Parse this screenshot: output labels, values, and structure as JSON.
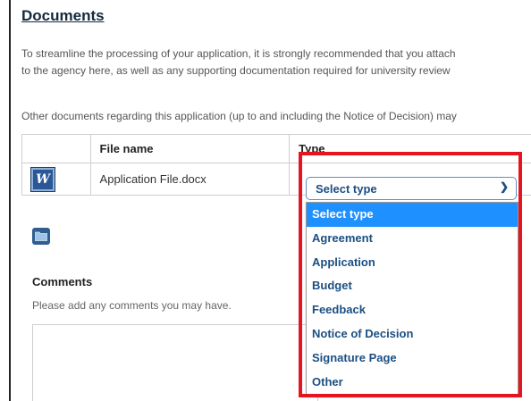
{
  "section": {
    "title": "Documents",
    "intro_line_1": "To streamline the processing of your application, it is strongly recommended that you attach",
    "intro_line_2": "to the agency here, as well as any supporting documentation required for university review",
    "other_docs_text": "Other documents regarding this application (up to and including the Notice of Decision) may"
  },
  "files_table": {
    "headers": {
      "file_name": "File name",
      "type": "Type"
    },
    "rows": [
      {
        "icon": "word-document-icon",
        "file_name": "Application File.docx",
        "type_value": "Select type"
      }
    ]
  },
  "type_dropdown": {
    "selected": "Select type",
    "options": [
      "Select type",
      "Agreement",
      "Application",
      "Budget",
      "Feedback",
      "Notice of Decision",
      "Signature Page",
      "Other"
    ]
  },
  "comments": {
    "label": "Comments",
    "help_text": "Please add any comments you may have.",
    "value": ""
  },
  "colors": {
    "title": "#14293f",
    "link_blue": "#1b4f83",
    "option_highlight": "#1e90ff",
    "callout_red": "#e5141e"
  }
}
